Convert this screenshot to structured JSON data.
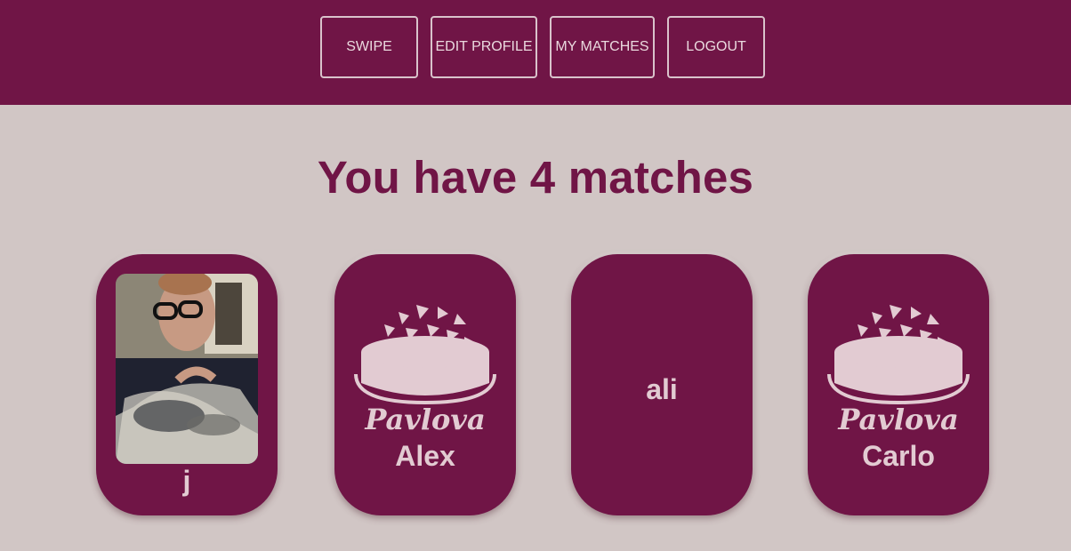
{
  "nav": {
    "items": [
      {
        "label": "SWIPE"
      },
      {
        "label": "EDIT PROFILE"
      },
      {
        "label": "MY MATCHES"
      },
      {
        "label": "LOGOUT"
      }
    ]
  },
  "heading": "You have 4 matches",
  "matches": [
    {
      "name": "j",
      "image": "photo"
    },
    {
      "name": "Alex",
      "image": "pavlova-logo",
      "logo_text": "Pavlova"
    },
    {
      "name": "ali",
      "image": "none"
    },
    {
      "name": "Carlo",
      "image": "pavlova-logo",
      "logo_text": "Pavlova"
    }
  ],
  "colors": {
    "brand": "#701546",
    "background": "#d1c6c5",
    "text_light": "#e2cbd2"
  }
}
